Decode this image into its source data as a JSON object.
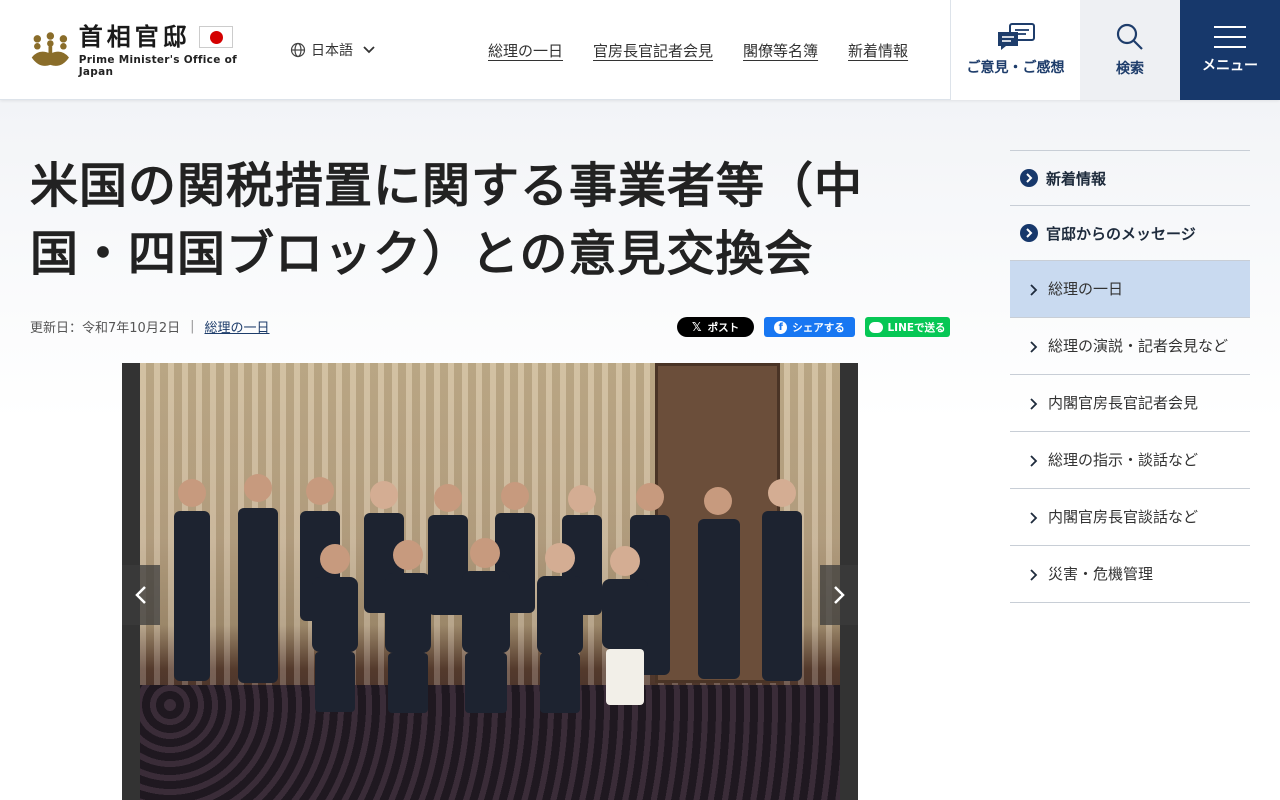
{
  "header": {
    "logo_jp": "首相官邸",
    "logo_en": "Prime Minister's Office of Japan",
    "language": "日本語",
    "nav": [
      {
        "label": "総理の一日"
      },
      {
        "label": "官房長官記者会見"
      },
      {
        "label": "閣僚等名簿"
      },
      {
        "label": "新着情報"
      }
    ],
    "opinion_label": "ご意見・ご感想",
    "search_label": "検索",
    "menu_label": "メニュー"
  },
  "article": {
    "title": "米国の関税措置に関する事業者等（中国・四国ブロック）との意見交換会",
    "updated_label": "更新日：",
    "updated_date": "令和7年10月2日",
    "category_link": "総理の一日"
  },
  "share": {
    "x_label": "ポスト",
    "facebook_label": "シェアする",
    "line_label": "LINEで送る"
  },
  "sidebar": {
    "items": [
      {
        "label": "新着情報",
        "type": "main"
      },
      {
        "label": "官邸からのメッセージ",
        "type": "main"
      },
      {
        "label": "総理の一日",
        "type": "sub",
        "active": true
      },
      {
        "label": "総理の演説・記者会見など",
        "type": "sub"
      },
      {
        "label": "内閣官房長官記者会見",
        "type": "sub"
      },
      {
        "label": "総理の指示・談話など",
        "type": "sub"
      },
      {
        "label": "内閣官房長官談話など",
        "type": "sub"
      },
      {
        "label": "災害・危機管理",
        "type": "sub"
      }
    ]
  },
  "colors": {
    "navy": "#17386b",
    "active_bg": "#c9daf0",
    "x": "#000000",
    "facebook": "#1877f2",
    "line": "#06c755"
  }
}
